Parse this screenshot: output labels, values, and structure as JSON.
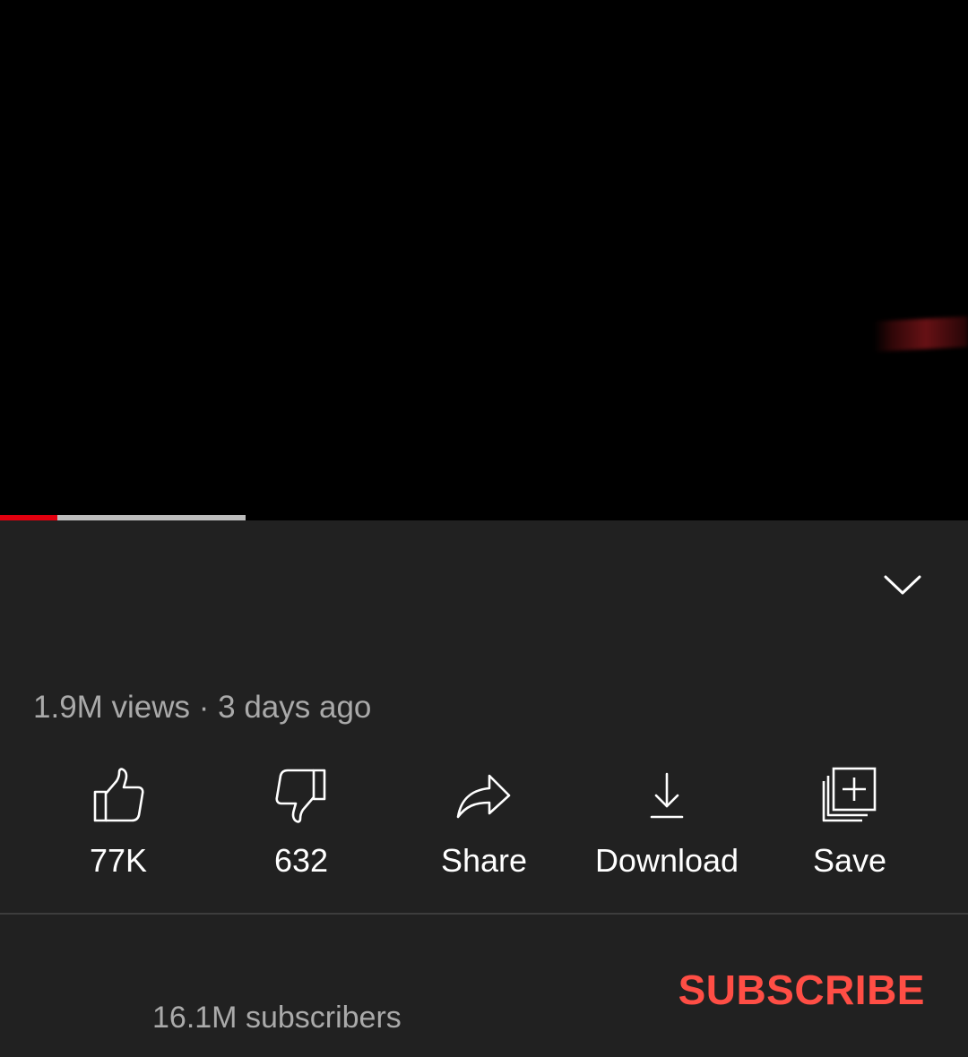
{
  "player": {
    "progress_played_fraction": 0.059,
    "progress_buffered_fraction": 0.254,
    "played_color": "#e3000f",
    "buffer_color": "#bdbdbd"
  },
  "expand": {
    "icon": "chevron-down-icon"
  },
  "video": {
    "meta": "1.9M views · 3 days ago"
  },
  "actions": [
    {
      "id": "like",
      "icon": "thumbs-up-icon",
      "label": "77K"
    },
    {
      "id": "dislike",
      "icon": "thumbs-down-icon",
      "label": "632"
    },
    {
      "id": "share",
      "icon": "share-icon",
      "label": "Share"
    },
    {
      "id": "download",
      "icon": "download-icon",
      "label": "Download"
    },
    {
      "id": "save",
      "icon": "save-to-playlist-icon",
      "label": "Save"
    }
  ],
  "channel": {
    "subscribers": "16.1M subscribers",
    "subscribe_label": "SUBSCRIBE",
    "subscribe_color": "#ff4e45"
  }
}
